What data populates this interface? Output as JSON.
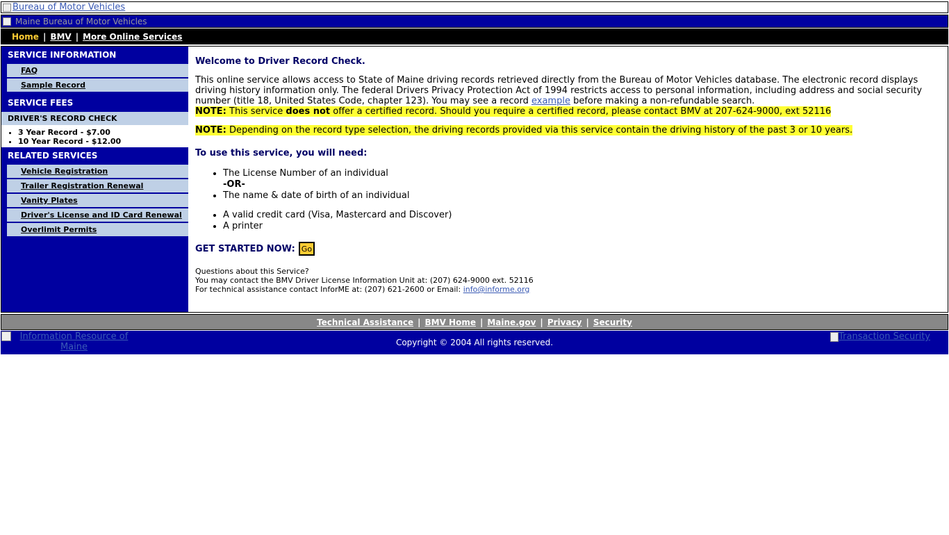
{
  "header": {
    "logo_alt": "Bureau of Motor Vehicles",
    "banner_alt": "Maine Bureau of Motor Vehicles"
  },
  "nav": {
    "items": [
      "Home",
      "BMV",
      "More Online Services"
    ],
    "separator": "|"
  },
  "sidebar": {
    "service_information_heading": "SERVICE INFORMATION",
    "info_links": [
      "FAQ",
      "Sample Record"
    ],
    "service_fees_heading": "SERVICE FEES",
    "fees_subheading": "DRIVER'S RECORD CHECK",
    "fees": [
      "3 Year Record - $7.00",
      "10 Year Record - $12.00"
    ],
    "related_services_heading": "RELATED SERVICES",
    "related_links": [
      "Vehicle Registration",
      "Trailer Registration Renewal",
      "Vanity Plates",
      "Driver's License and ID Card Renewal",
      "Overlimit Permits"
    ]
  },
  "content": {
    "title": "Welcome to Driver Record Check.",
    "intro_before_link": "This online service allows access to State of Maine driving records retrieved directly from the Bureau of Motor Vehicles database. The electronic record displays driving history information only. The federal Drivers Privacy Protection Act of 1994 restricts access to personal information, including address and social security number (title 18, United States Code, chapter 123). You may see a record ",
    "intro_link": "example",
    "intro_after_link": " before making a non-refundable search.",
    "note_label": "NOTE:",
    "note1_before": " This service ",
    "note1_bold": "does not",
    "note1_after": " offer a certified record. Should you require a certified record, please contact BMV at 207-624-9000, ext 52116",
    "note2_text": " Depending on the record type selection, the driving records provided via this service contain the driving history of the past 3 or 10 years.",
    "need_heading": "To use this service, you will need:",
    "need_items": [
      "The License Number of an individual",
      "-OR-",
      "The name & date of birth of an individual",
      "A valid credit card (Visa, Mastercard and Discover)",
      "A printer"
    ],
    "get_started_label": "GET STARTED NOW:",
    "go_button": "Go",
    "questions": [
      "Questions about this Service?",
      "You may contact the BMV Driver License Information Unit at: (207) 624-9000 ext. 52116",
      "For technical assistance contact InforME at: (207) 621-2600 or Email: "
    ],
    "email": "info@informe.org"
  },
  "footer": {
    "links": [
      "Technical Assistance",
      "BMV Home",
      "Maine.gov",
      "Privacy",
      "Security"
    ],
    "separator": "|",
    "left_alt": "Information Resource of Maine",
    "copyright": "Copyright © 2004 All rights reserved.",
    "right_alt": "Transaction Security"
  },
  "colors": {
    "primary_blue": "#0000a0",
    "side_item_bg": "#bfd0e6",
    "note_highlight": "#ffff33",
    "nav_active": "#ffcc33",
    "heading_navy": "#000066",
    "footer_gray": "#888888"
  }
}
